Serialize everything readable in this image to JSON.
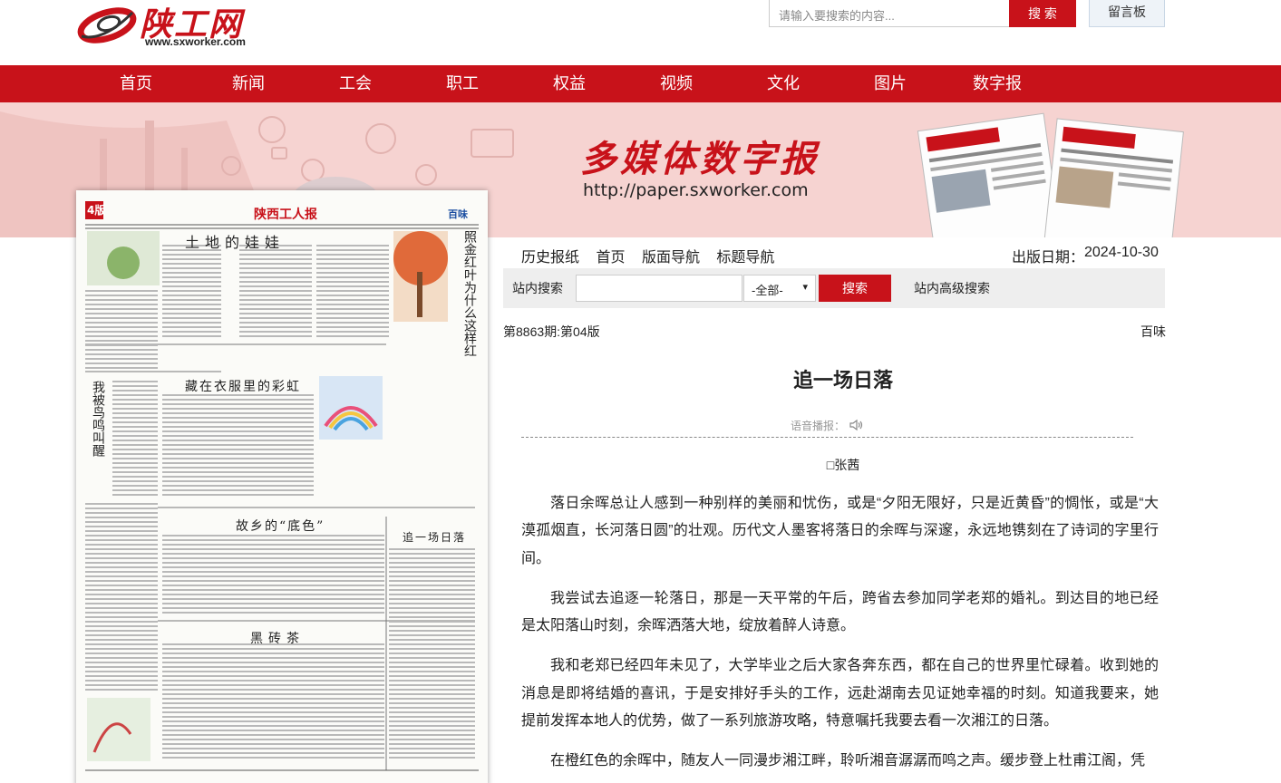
{
  "site": {
    "logo_text": "陕工网",
    "logo_url": "www.sxworker.com"
  },
  "search": {
    "placeholder": "请输入要搜索的内容...",
    "button": "搜 索",
    "guestbook": "留言板"
  },
  "nav": {
    "items": [
      "首页",
      "新闻",
      "工会",
      "职工",
      "权益",
      "视频",
      "文化",
      "图片",
      "数字报"
    ]
  },
  "banner": {
    "title": "多媒体数字报",
    "url": "http://paper.sxworker.com"
  },
  "colors": {
    "brand_red": "#c8121a",
    "banner_pink": "#f6d3d1"
  },
  "page_image": {
    "page_no": "4版",
    "masthead": "陕西工人报",
    "section": "百味",
    "headlines": [
      "土地的娃娃",
      "照金红叶为什么这样红",
      "我被鸟鸣叫醒",
      "藏在衣服里的彩虹",
      "故乡的“底色”",
      "追一场日落",
      "黑砖茶"
    ]
  },
  "toolbar": {
    "links": [
      "历史报纸",
      "首页",
      "版面导航",
      "标题导航"
    ],
    "pub_date_label": "出版日期：",
    "pub_date": "2024-10-30"
  },
  "site_search": {
    "label": "站内搜索",
    "scope": "-全部-",
    "button": "搜索",
    "advanced": "站内高级搜索"
  },
  "issue": {
    "info": "第8863期:第04版",
    "section": "百味"
  },
  "article": {
    "title": "追一场日落",
    "voice_label": "语音播报：",
    "author": "□张茜",
    "paragraphs": [
      "落日余晖总让人感到一种别样的美丽和忧伤，或是“夕阳无限好，只是近黄昏”的惆怅，或是“大漠孤烟直，长河落日圆”的壮观。历代文人墨客将落日的余晖与深邃，永远地镌刻在了诗词的字里行间。",
      "我尝试去追逐一轮落日，那是一天平常的午后，跨省去参加同学老郑的婚礼。到达目的地已经是太阳落山时刻，余晖洒落大地，绽放着醉人诗意。",
      "我和老郑已经四年未见了，大学毕业之后大家各奔东西，都在自己的世界里忙碌着。收到她的消息是即将结婚的喜讯，于是安排好手头的工作，远赴湖南去见证她幸福的时刻。知道我要来，她提前发挥本地人的优势，做了一系列旅游攻略，特意嘱托我要去看一次湘江的日落。",
      "在橙红色的余晖中，随友人一同漫步湘江畔，聆听湘音潺潺而鸣之声。缓步登上杜甫江阁，凭"
    ]
  }
}
